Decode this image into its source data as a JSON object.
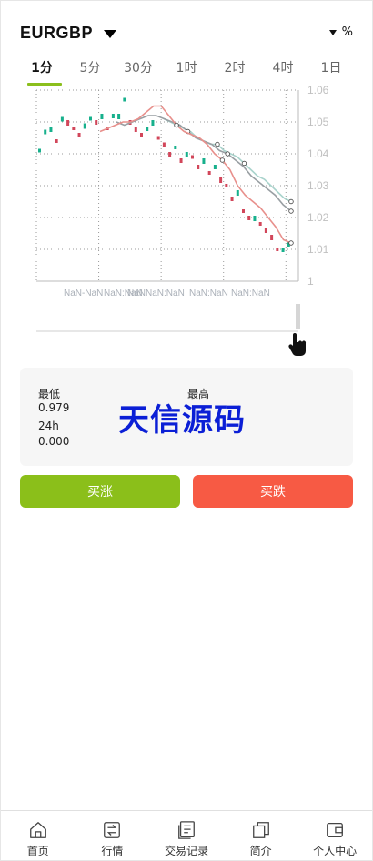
{
  "header": {
    "pair": "EURGBP",
    "pct_label": "%"
  },
  "tabs": [
    {
      "label": "1分",
      "active": true
    },
    {
      "label": "5分",
      "active": false
    },
    {
      "label": "30分",
      "active": false
    },
    {
      "label": "1时",
      "active": false
    },
    {
      "label": "2时",
      "active": false
    },
    {
      "label": "4时",
      "active": false
    },
    {
      "label": "1日",
      "active": false
    }
  ],
  "chart_data": {
    "type": "candlestick",
    "y_ticks": [
      "1.06",
      "1.05",
      "1.04",
      "1.03",
      "1.02",
      "1.01",
      "1"
    ],
    "x_ticks": [
      "NaN-NaN",
      "NaN:NaN",
      "NaN",
      "NaN:NaN",
      "NaN:NaN",
      "NaN:NaN"
    ],
    "ylim": [
      1.0,
      1.06
    ],
    "grid": true,
    "colors": {
      "up": "#17b08c",
      "down": "#d2465a",
      "ma1": "#e8908c",
      "ma2": "#999fa3",
      "ma3": "#a9d3cc"
    },
    "candles": [
      1.041,
      1.047,
      1.048,
      1.044,
      1.051,
      1.05,
      1.048,
      1.046,
      1.049,
      1.051,
      1.05,
      1.052,
      1.048,
      1.052,
      1.052,
      1.057,
      1.05,
      1.048,
      1.046,
      1.048,
      1.05,
      1.045,
      1.043,
      1.04,
      1.042,
      1.038,
      1.04,
      1.039,
      1.036,
      1.038,
      1.034,
      1.036,
      1.032,
      1.03,
      1.026,
      1.028,
      1.022,
      1.02,
      1.02,
      1.018,
      1.016,
      1.014,
      1.01,
      1.01,
      1.012
    ],
    "ma1": [
      1.047,
      1.048,
      1.049,
      1.05,
      1.05,
      1.051,
      1.053,
      1.055,
      1.055,
      1.052,
      1.049,
      1.047,
      1.046,
      1.045,
      1.043,
      1.04,
      1.038,
      1.035,
      1.03,
      1.027,
      1.025,
      1.023,
      1.02,
      1.017,
      1.013,
      1.012
    ],
    "ma2": [
      1.05,
      1.049,
      1.05,
      1.051,
      1.052,
      1.052,
      1.051,
      1.05,
      1.049,
      1.047,
      1.045,
      1.044,
      1.043,
      1.041,
      1.04,
      1.038,
      1.036,
      1.033,
      1.031,
      1.029,
      1.027,
      1.024,
      1.022
    ],
    "ma3": [
      1.051,
      1.05,
      1.049,
      1.048,
      1.047,
      1.045,
      1.044,
      1.043,
      1.043,
      1.041,
      1.04,
      1.039,
      1.037,
      1.035,
      1.033,
      1.032,
      1.03,
      1.028,
      1.026,
      1.025
    ]
  },
  "stats": {
    "low_label": "最低",
    "low_value": "0.979",
    "high_label": "最高",
    "h24_label": "24h",
    "h24_value": "0.000",
    "watermark": "天信源码"
  },
  "buttons": {
    "buy_up": "买涨",
    "buy_down": "买跌"
  },
  "nav": [
    {
      "label": "首页",
      "icon": "home-icon"
    },
    {
      "label": "行情",
      "icon": "exchange-icon"
    },
    {
      "label": "交易记录",
      "icon": "records-icon"
    },
    {
      "label": "简介",
      "icon": "copy-icon"
    },
    {
      "label": "个人中心",
      "icon": "wallet-icon"
    }
  ]
}
